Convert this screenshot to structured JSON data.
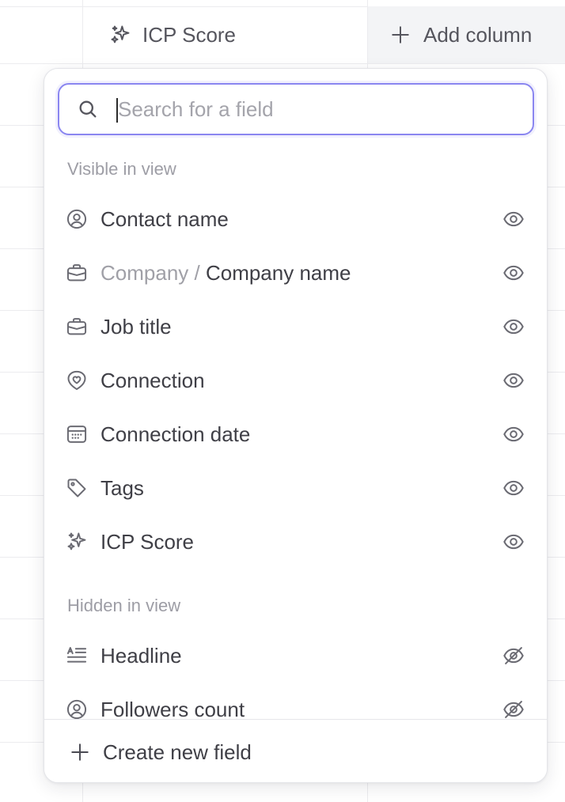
{
  "table": {
    "icp_column_label": "ICP Score",
    "add_column_label": "Add column"
  },
  "panel": {
    "search": {
      "placeholder": "Search for a field",
      "value": ""
    },
    "visible_section_label": "Visible in view",
    "visible_fields": [
      {
        "icon": "user-circle-icon",
        "prefix": "",
        "label": "Contact name",
        "visibility_icon": "eye-icon"
      },
      {
        "icon": "briefcase-icon",
        "prefix": "Company / ",
        "label": "Company name",
        "visibility_icon": "eye-icon"
      },
      {
        "icon": "briefcase-icon",
        "prefix": "",
        "label": "Job title",
        "visibility_icon": "eye-icon"
      },
      {
        "icon": "heart-shield-icon",
        "prefix": "",
        "label": "Connection",
        "visibility_icon": "eye-icon"
      },
      {
        "icon": "calendar-icon",
        "prefix": "",
        "label": "Connection date",
        "visibility_icon": "eye-icon"
      },
      {
        "icon": "tag-icon",
        "prefix": "",
        "label": "Tags",
        "visibility_icon": "eye-icon"
      },
      {
        "icon": "sparkles-icon",
        "prefix": "",
        "label": "ICP Score",
        "visibility_icon": "eye-icon"
      }
    ],
    "hidden_section_label": "Hidden in view",
    "hidden_fields": [
      {
        "icon": "text-align-icon",
        "label": "Headline",
        "visibility_icon": "eye-off-icon"
      },
      {
        "icon": "user-circle-icon",
        "label": "Followers count",
        "visibility_icon": "eye-off-icon"
      }
    ],
    "create_label": "Create new field"
  },
  "colors": {
    "focus_ring": "#8a86f0",
    "icon_gray": "#6b6b73",
    "muted_text": "#9d9da5",
    "header_bg": "#f3f4f6"
  }
}
